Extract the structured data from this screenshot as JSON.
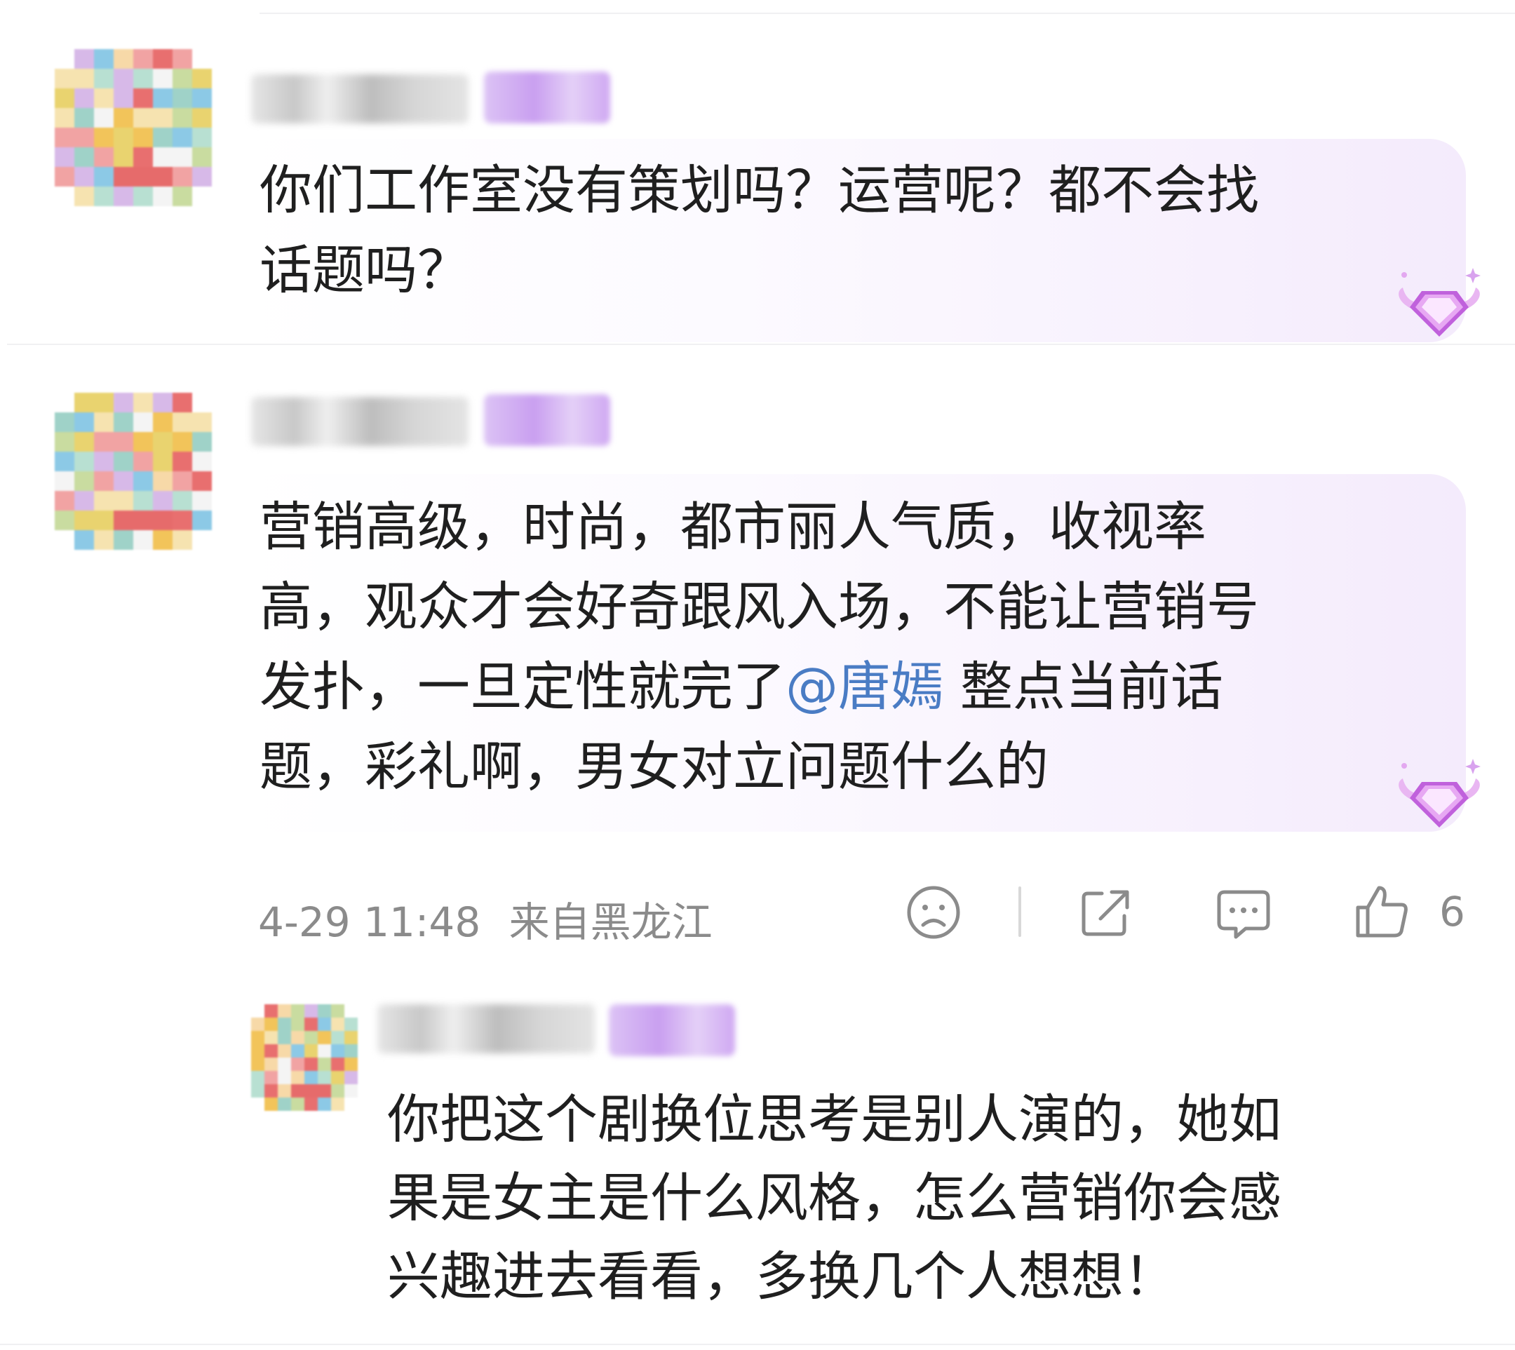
{
  "comments": [
    {
      "text_lines": [
        "你们工作室没有策划吗？运营呢？都不会找",
        "话题吗？"
      ]
    },
    {
      "text_lines_a": [
        "营销高级，时尚，都市丽人气质，收视率",
        "高，观众才会好奇跟风入场，不能让营销号"
      ],
      "line3_before": "发扑，一旦定性就完了",
      "mention": "@唐嫣",
      "line3_after": " 整点当前话",
      "line4": "题，彩礼啊，男女对立问题什么的",
      "meta": {
        "time": "4-29 11:48",
        "location": "来自黑龙江",
        "like_count": "6"
      }
    }
  ],
  "reply": {
    "text_lines": [
      "你把这个剧换位思考是别人演的，她如",
      "果是女主是什么风格，怎么营销你会感",
      "兴趣进去看看，多换几个人想想！"
    ]
  },
  "icons": [
    "sad-face-icon",
    "share-icon",
    "comment-icon",
    "thumbs-up-icon",
    "diamond-badge-icon"
  ],
  "colors": {
    "mention": "#4a7cc4",
    "bubble_tint": "#f4ebfc",
    "meta_gray": "#8b8b8b"
  }
}
